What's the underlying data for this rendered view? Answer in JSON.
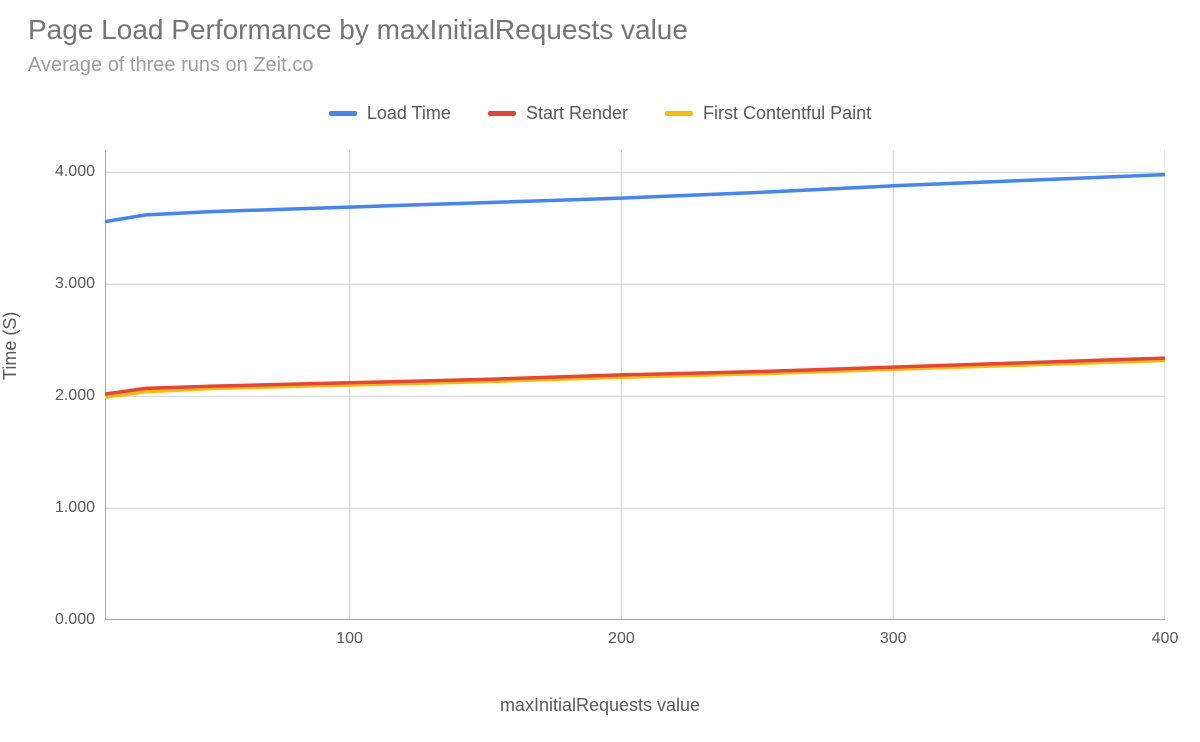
{
  "title": "Page Load Performance by maxInitialRequests value",
  "subtitle": "Average of three runs on Zeit.co",
  "legend": {
    "load_time": "Load Time",
    "start_render": "Start Render",
    "fcp": "First Contentful Paint"
  },
  "axes": {
    "ylabel": "Time (S)",
    "xlabel": "maxInitialRequests value",
    "yticks": {
      "t0": "0.000",
      "t1": "1.000",
      "t2": "2.000",
      "t3": "3.000",
      "t4": "4.000"
    },
    "xticks": {
      "t100": "100",
      "t200": "200",
      "t300": "300",
      "t400": "400"
    }
  },
  "colors": {
    "load_time": "#4285f4",
    "start_render": "#ea4335",
    "fcp": "#fbbc04"
  },
  "chart_data": {
    "type": "line",
    "title": "Page Load Performance by maxInitialRequests value",
    "subtitle": "Average of three runs on Zeit.co",
    "xlabel": "maxInitialRequests value",
    "ylabel": "Time (S)",
    "xlim": [
      10,
      400
    ],
    "ylim": [
      0,
      4.2
    ],
    "grid": true,
    "legend_position": "top",
    "x": [
      10,
      25,
      50,
      100,
      150,
      200,
      250,
      300,
      350,
      400
    ],
    "series": [
      {
        "name": "Load Time",
        "color": "#4285f4",
        "values": [
          3.56,
          3.62,
          3.65,
          3.69,
          3.73,
          3.77,
          3.82,
          3.88,
          3.93,
          3.98
        ]
      },
      {
        "name": "Start Render",
        "color": "#ea4335",
        "values": [
          2.02,
          2.07,
          2.09,
          2.12,
          2.15,
          2.19,
          2.22,
          2.26,
          2.3,
          2.34
        ]
      },
      {
        "name": "First Contentful Paint",
        "color": "#fbbc04",
        "values": [
          1.99,
          2.04,
          2.07,
          2.1,
          2.13,
          2.17,
          2.2,
          2.24,
          2.28,
          2.32
        ]
      }
    ]
  }
}
